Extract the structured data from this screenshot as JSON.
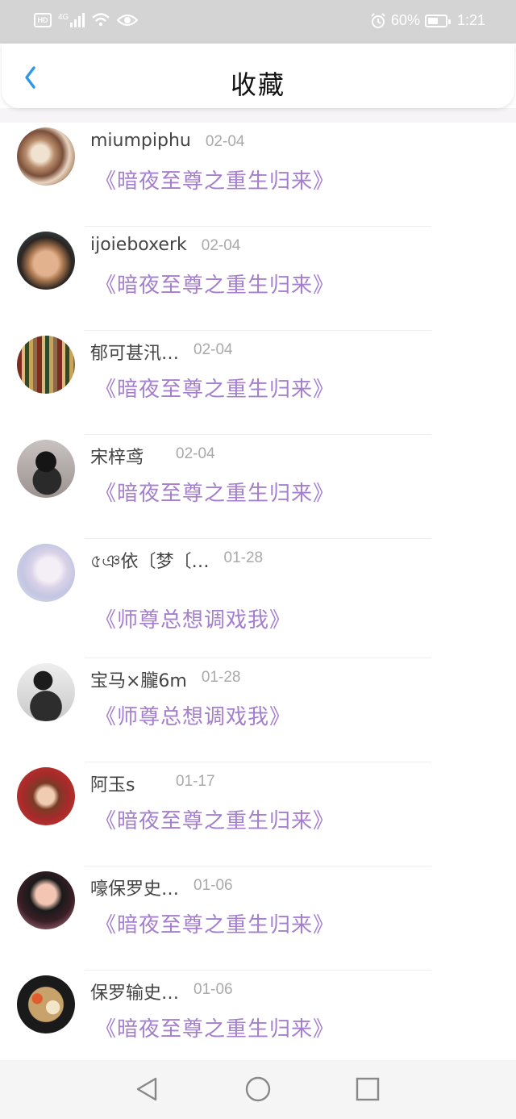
{
  "status_bar": {
    "hd_label": "HD",
    "network_label": "4G",
    "battery_percent": "60%",
    "battery_level": 0.6,
    "time": "1:21",
    "icons": [
      "hd-icon",
      "signal-icon",
      "wifi-icon",
      "eye-icon",
      "alarm-icon",
      "battery-icon"
    ]
  },
  "header": {
    "title": "收藏",
    "back_icon": "chevron-left-icon",
    "accent_color": "#2e98e8"
  },
  "colors": {
    "book_title": "#a57fce",
    "name": "#444444",
    "date": "#a9a9a9"
  },
  "favorites": [
    {
      "name": "miumpiphu",
      "date": "02-04",
      "book": "《暗夜至尊之重生归来》",
      "avatar": "conch-shell-photo"
    },
    {
      "name": "ijoieboxerk",
      "date": "02-04",
      "book": "《暗夜至尊之重生归来》",
      "avatar": "woman-portrait-photo"
    },
    {
      "name": "郁可甚汛…",
      "date": "02-04",
      "book": "《暗夜至尊之重生归来》",
      "avatar": "bookshelf-photo"
    },
    {
      "name": "宋梓鸢",
      "date": "02-04",
      "book": "《暗夜至尊之重生归来》",
      "avatar": "girl-with-bun-photo"
    },
    {
      "name": "৫ঞ依〔梦〔…",
      "date": "01-28",
      "book": "《师尊总想调戏我》",
      "avatar": "pale-anime-girl-photo"
    },
    {
      "name": "宝马×朧6m",
      "date": "01-28",
      "book": "《师尊总想调戏我》",
      "avatar": "sunglasses-person-photo"
    },
    {
      "name": "阿玉s",
      "date": "01-17",
      "book": "《暗夜至尊之重生归来》",
      "avatar": "red-anime-girl-photo"
    },
    {
      "name": "嚎保罗史…",
      "date": "01-06",
      "book": "《暗夜至尊之重生归来》",
      "avatar": "selfie-woman-photo"
    },
    {
      "name": "保罗输史…",
      "date": "01-06",
      "book": "《暗夜至尊之重生归来》",
      "avatar": "food-bowl-photo"
    }
  ],
  "nav_bar": {
    "back_icon": "triangle-back-icon",
    "home_icon": "circle-home-icon",
    "recents_icon": "square-recents-icon"
  }
}
